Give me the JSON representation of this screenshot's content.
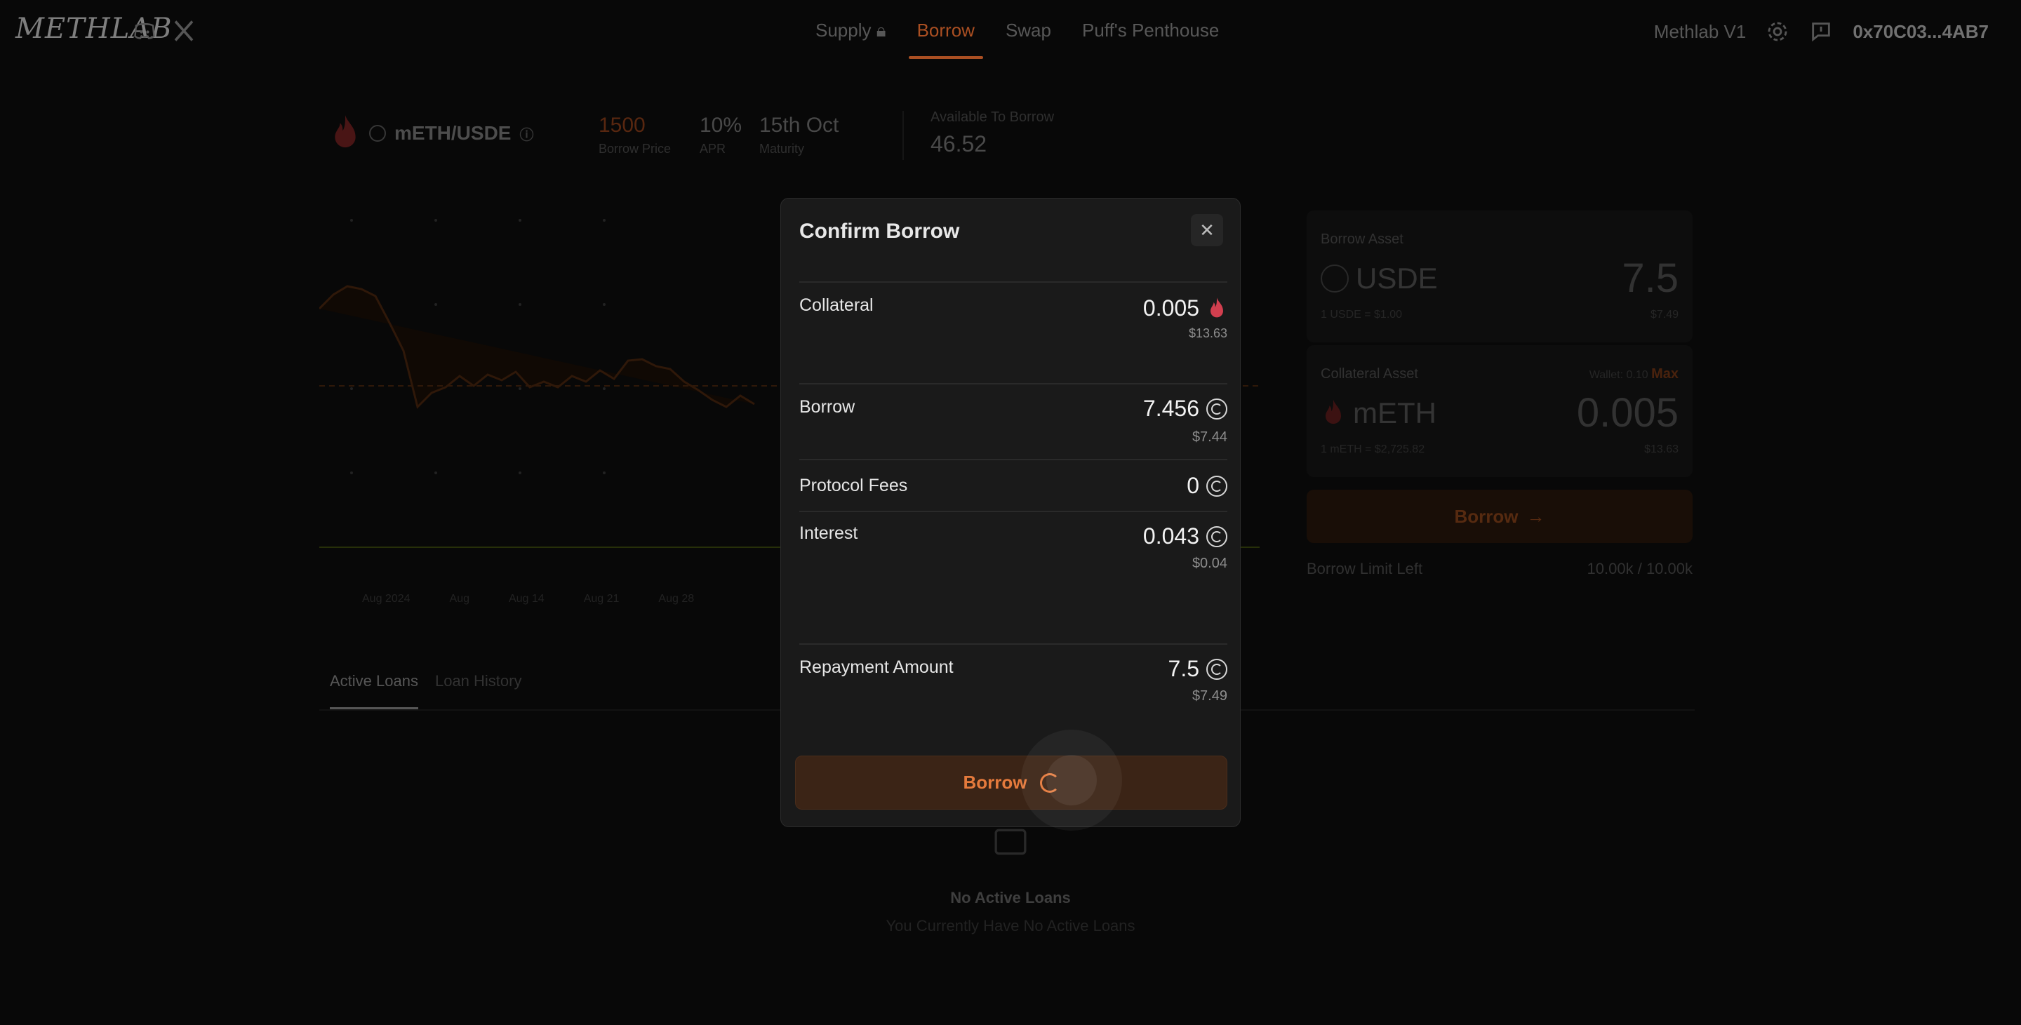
{
  "nav": {
    "logo": "METHLAB",
    "links": [
      {
        "label": "Supply"
      },
      {
        "label": "Borrow"
      },
      {
        "label": "Swap"
      },
      {
        "label": "Puff's Penthouse"
      }
    ],
    "version": "Methlab V1",
    "address": "0x70C03...4AB7"
  },
  "market": {
    "pair": "mETH/USDE",
    "borrow_price": "1500",
    "borrow_price_label": "Borrow Price",
    "apr": "10%",
    "apr_label": "APR",
    "maturity": "15th Oct",
    "maturity_label": "Maturity",
    "available_label": "Available To Borrow",
    "available_value": "46.52"
  },
  "chart_axis": [
    "Aug 2024",
    "Aug",
    "Aug 14",
    "Aug 21",
    "Aug 28"
  ],
  "tabs": [
    "Active Loans",
    "Loan History"
  ],
  "empty_state": {
    "title": "No Active Loans",
    "subtitle": "You Currently Have No Active Loans"
  },
  "side": {
    "borrow_asset_label": "Borrow Asset",
    "borrow_asset": "USDE",
    "borrow_amount": "7.5",
    "borrow_usd": "$7.49",
    "borrow_rate": "1 USDE = $1.00",
    "collateral_asset_label": "Collateral Asset",
    "wallet": "Wallet: 0.10",
    "max": "Max",
    "collateral_asset": "mETH",
    "collateral_amount": "0.005",
    "collateral_usd": "$13.63",
    "collateral_rate": "1 mETH = $2,725.82",
    "button": "Borrow",
    "limit_label": "Borrow Limit Left",
    "limit_value": "10.00k",
    "limit_total": "10.00k"
  },
  "modal": {
    "title": "Confirm Borrow",
    "rows": [
      {
        "label": "Collateral",
        "value": "0.005",
        "usd": "$13.63"
      },
      {
        "label": "Borrow",
        "value": "7.456",
        "usd": "$7.44"
      },
      {
        "label": "Protocol Fees",
        "value": "0"
      },
      {
        "label": "Interest",
        "value": "0.043",
        "usd": "$0.04"
      },
      {
        "label": "Repayment Amount",
        "value": "7.5",
        "usd": "$7.49"
      }
    ],
    "button": "Borrow"
  },
  "colors": {
    "accent": "#d0612a",
    "modal_bg": "#1a1a1a",
    "button_bg": "#3b2416"
  }
}
